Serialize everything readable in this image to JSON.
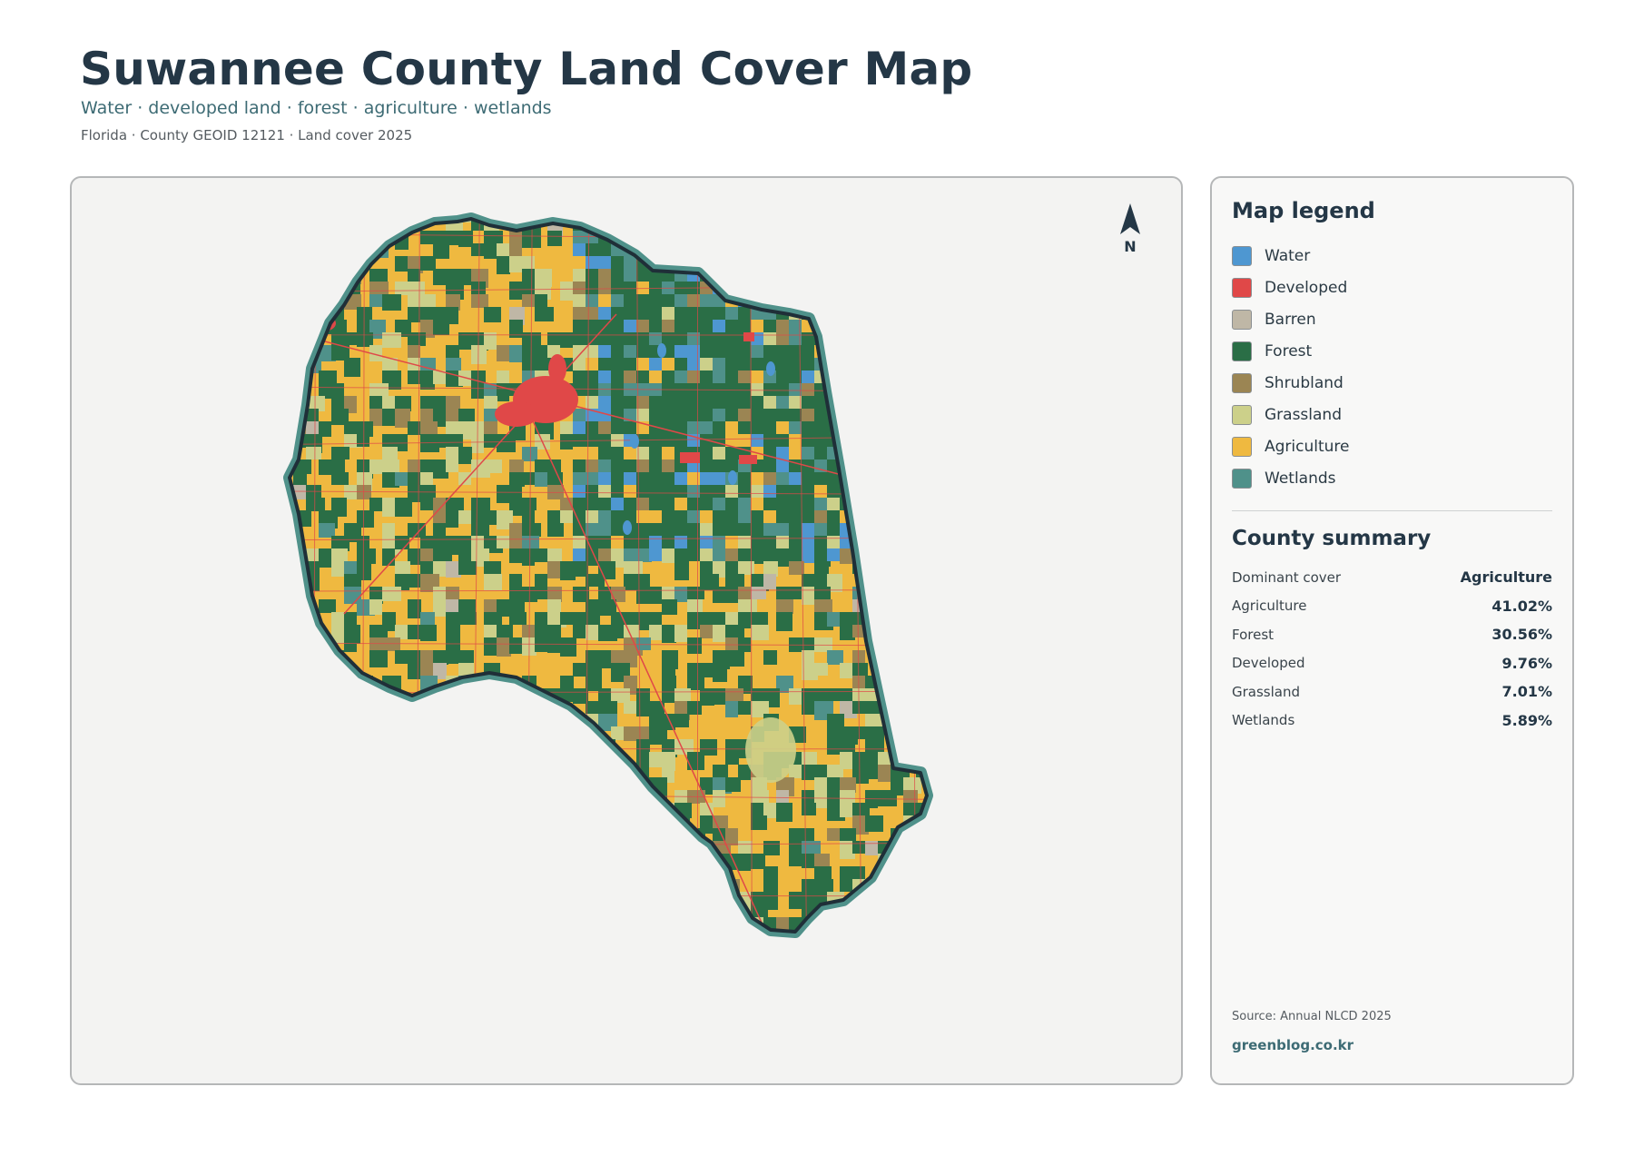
{
  "header": {
    "title": "Suwannee County Land Cover Map",
    "subtitle": "Water · developed land · forest · agriculture · wetlands",
    "meta": "Florida · County GEOID 12121 · Land cover 2025"
  },
  "map": {
    "north_label": "N",
    "colors": {
      "water": "#4e97d1",
      "developed": "#e04848",
      "barren": "#bfb7a6",
      "forest": "#2a6e46",
      "shrubland": "#9b8553",
      "grassland": "#ccd08a",
      "agriculture": "#efb940",
      "wetlands": "#4f918a",
      "boundary": "#1f2f38"
    }
  },
  "legend": {
    "title": "Map legend",
    "items": [
      {
        "label": "Water",
        "color": "#4e97d1"
      },
      {
        "label": "Developed",
        "color": "#e04848"
      },
      {
        "label": "Barren",
        "color": "#bfb7a6"
      },
      {
        "label": "Forest",
        "color": "#2a6e46"
      },
      {
        "label": "Shrubland",
        "color": "#9b8553"
      },
      {
        "label": "Grassland",
        "color": "#ccd08a"
      },
      {
        "label": "Agriculture",
        "color": "#efb940"
      },
      {
        "label": "Wetlands",
        "color": "#4f918a"
      }
    ]
  },
  "summary": {
    "title": "County summary",
    "rows": [
      {
        "key": "Dominant cover",
        "value": "Agriculture"
      },
      {
        "key": "Agriculture",
        "value": "41.02%"
      },
      {
        "key": "Forest",
        "value": "30.56%"
      },
      {
        "key": "Developed",
        "value": "9.76%"
      },
      {
        "key": "Grassland",
        "value": "7.01%"
      },
      {
        "key": "Wetlands",
        "value": "5.89%"
      }
    ]
  },
  "footer": {
    "source": "Source: Annual NLCD 2025",
    "site": "greenblog.co.kr"
  }
}
